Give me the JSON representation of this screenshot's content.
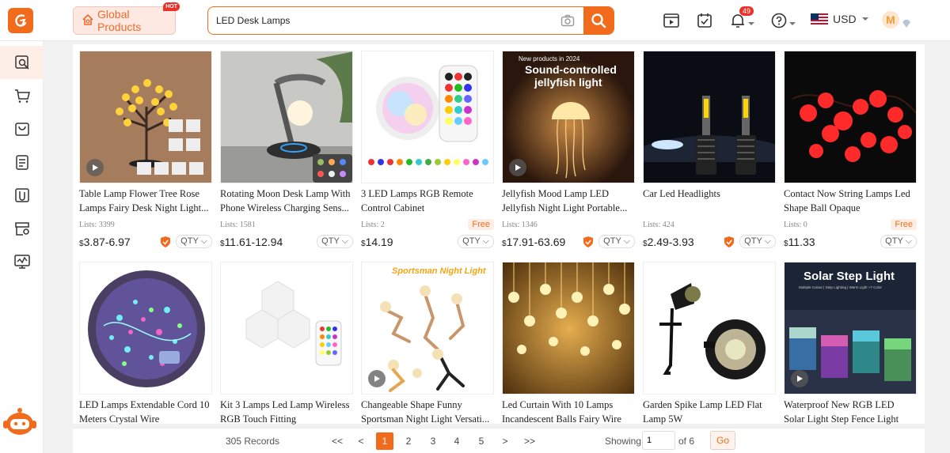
{
  "header": {
    "global_products_label": "Global Products",
    "hot_badge": "HOT",
    "search_value": "LED Desk Lamps",
    "notification_count": "49",
    "currency": "USD",
    "avatar_initial": "M"
  },
  "colors": {
    "accent": "#f26b1d",
    "badge": "#e8332b"
  },
  "sidebar": {
    "items": [
      {
        "icon": "product-search-icon"
      },
      {
        "icon": "cart-icon"
      },
      {
        "icon": "shopping-bag-icon"
      },
      {
        "icon": "orders-list-icon"
      },
      {
        "icon": "clip-icon"
      },
      {
        "icon": "store-settings-icon"
      },
      {
        "icon": "analytics-monitor-icon"
      }
    ]
  },
  "products": [
    {
      "title": "Table Lamp Flower Tree Rose Lamps Fairy Desk Night Light...",
      "lists": "Lists: 3399",
      "price": "3.87-6.97",
      "free": "",
      "qty": "QTY",
      "video": true,
      "shield": true
    },
    {
      "title": "Rotating Moon Desk Lamp With Phone Wireless Charging Sens...",
      "lists": "Lists: 1581",
      "price": "11.61-12.94",
      "free": "",
      "qty": "QTY",
      "video": false,
      "shield": false
    },
    {
      "title": "3 LED Lamps RGB Remote Control Cabinet",
      "lists": "Lists: 2",
      "price": "14.19",
      "free": "Free",
      "qty": "QTY",
      "video": false,
      "shield": false
    },
    {
      "title": "Jellyfish Mood Lamp LED Jellyfish Night Light Portable...",
      "lists": "Lists: 1346",
      "price": "17.91-63.69",
      "free": "",
      "qty": "QTY",
      "video": true,
      "shield": true
    },
    {
      "title": "Car Led Headlights",
      "lists": "Lists: 424",
      "price": "2.49-3.93",
      "free": "",
      "qty": "QTY",
      "video": false,
      "shield": true
    },
    {
      "title": "Contact Now String Lamps Led Shape Ball Opaque",
      "lists": "Lists: 0",
      "price": "11.33",
      "free": "Free",
      "qty": "QTY",
      "video": false,
      "shield": false
    },
    {
      "title": "LED Lamps Extendable Cord 10 Meters Crystal Wire",
      "video": false
    },
    {
      "title": "Kit 3 Lamps Led Lamp Wireless RGB Touch Fitting",
      "video": false
    },
    {
      "title": "Changeable Shape Funny Sportsman Night Light Versati...",
      "video": true
    },
    {
      "title": "Led Curtain With 10 Lamps Incandescent Balls Fairy Wire",
      "video": false
    },
    {
      "title": "Garden Spike Lamp LED Flat Lamp 5W",
      "video": false
    },
    {
      "title": "Waterproof New RGB LED Solar Light Step Fence Light",
      "video": true
    }
  ],
  "image_text": {
    "jellyfish_tag": "New products in 2024",
    "jellyfish_headline_1": "Sound-controlled",
    "jellyfish_headline_2": "jellyfish light",
    "sportsman_banner": "Sportsman Night Light",
    "solar_banner": "Solar Step Light",
    "solar_sub": "Multiple Colour | Step Lighting | Warm Light +7 Color"
  },
  "pagination": {
    "records": "305 Records",
    "first": "<<",
    "prev": "<",
    "pages": [
      "1",
      "2",
      "3",
      "4",
      "5"
    ],
    "next": ">",
    "last": ">>",
    "showing_label": "Showing:",
    "current_page": "1",
    "of_label": "of 6",
    "go_label": "Go"
  }
}
